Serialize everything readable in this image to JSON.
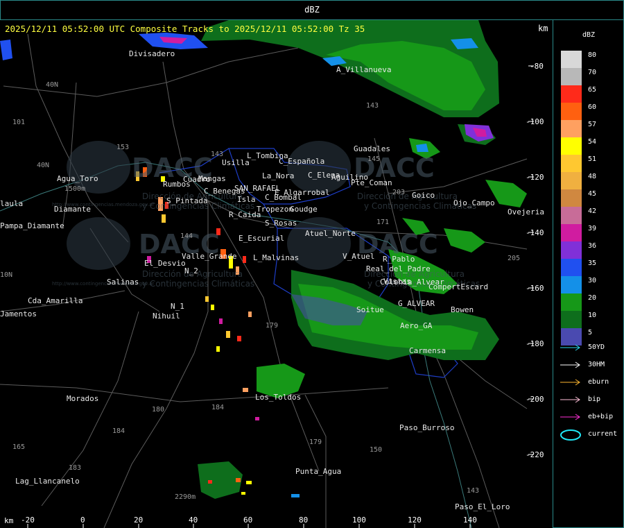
{
  "window": {
    "title": "dBZ"
  },
  "map": {
    "header": "2025/12/11 05:52:00 UTC Composite Tracks to 2025/12/11 05:52:00 Tz 35",
    "km_label_top": "km",
    "km_label_bottom": "km",
    "x_ticks": [
      "-20",
      "0",
      "20",
      "40",
      "60",
      "80",
      "100",
      "120",
      "140"
    ],
    "y_ticks": [
      "-80",
      "-100",
      "-120",
      "-140",
      "-160",
      "-180",
      "-200",
      "-220"
    ],
    "towns": [
      "Divisadero",
      "A_Villanueva",
      "Guadales",
      "L_Tombina",
      "Usilla",
      "C_Española",
      "C_Elena",
      "La_Nora",
      "Cuadro",
      "Mangas",
      "Rumbos",
      "C_Benegas",
      "SAN_RAFAEL",
      "E_Algarrobal",
      "Aguilino",
      "Isla",
      "C_Bombal",
      "Tropezon",
      "Goudge",
      "Agua_Toro",
      "Diamante",
      "Pampa_Diamante",
      "S_Pintada",
      "R_Caida",
      "S_Rosas",
      "Atuel_Norte",
      "E_Escurial",
      "Valle_Grande",
      "L_Malvinas",
      "V_Atuel",
      "R_Pablo",
      "El_Desvio",
      "Salinas",
      "Cda_Amarilla",
      "Nihuil",
      "N_1",
      "N_2",
      "Real_del_Padre",
      "Colonia_Alvear",
      "G_ALVEAR",
      "Bowen",
      "Soitue",
      "Aero_GA",
      "Carmensa",
      "Los_Toldos",
      "Morados",
      "Paso_Burroso",
      "Punta_Agua",
      "Lag_Llancanelo",
      "Paso_El_Loro",
      "Goico",
      "Ojo_Campo",
      "Ovejeria",
      "laula",
      "Jamentos",
      "Pte_Coman",
      "Vistas",
      "CompertEscard"
    ],
    "routes": [
      "40N",
      "40N",
      "101",
      "153",
      "143",
      "203",
      "171",
      "144",
      "10N",
      "143",
      "179",
      "184",
      "180",
      "184",
      "183",
      "179",
      "150",
      "143",
      "145",
      "205",
      "165"
    ],
    "spot_elevations": [
      "1500m",
      "2290m"
    ],
    "watermark": {
      "brand": "DACC",
      "line1": "Dirección de Agricultura",
      "line2": "y Contingencias Climáticas",
      "url": "http://www.contingencias.mendoza.gov.ar"
    }
  },
  "legend": {
    "unit": "dBZ",
    "scale": [
      {
        "label": "80",
        "color": "#d8d8d8"
      },
      {
        "label": "70",
        "color": "#b8b8b8"
      },
      {
        "label": "65",
        "color": "#ff2a1a"
      },
      {
        "label": "60",
        "color": "#ff6010"
      },
      {
        "label": "57",
        "color": "#ffa060"
      },
      {
        "label": "54",
        "color": "#ffff00"
      },
      {
        "label": "51",
        "color": "#ffc830"
      },
      {
        "label": "48",
        "color": "#f0b040"
      },
      {
        "label": "45",
        "color": "#d08840"
      },
      {
        "label": "42",
        "color": "#c86c98"
      },
      {
        "label": "39",
        "color": "#d01ca0"
      },
      {
        "label": "36",
        "color": "#8030d8"
      },
      {
        "label": "35",
        "color": "#2050f0"
      },
      {
        "label": "30",
        "color": "#1490e8"
      },
      {
        "label": "20",
        "color": "#169818"
      },
      {
        "label": "10",
        "color": "#0e6e1c"
      },
      {
        "label": "5",
        "color": "#4a4ab0"
      }
    ],
    "tracks": [
      {
        "label": "50YD",
        "color": "#2ad8f0",
        "icon": "arrow-icon"
      },
      {
        "label": "30HM",
        "color": "#ffffff",
        "icon": "arrow-icon"
      },
      {
        "label": "eburn",
        "color": "#ffb830",
        "icon": "arrow-icon"
      },
      {
        "label": "bip",
        "color": "#ffc0d8",
        "icon": "arrow-icon"
      },
      {
        "label": "eb+bip",
        "color": "#ff30d8",
        "icon": "arrow-icon"
      },
      {
        "label": "current",
        "color": "#20e8f8",
        "icon": "ellipse-icon"
      }
    ]
  }
}
